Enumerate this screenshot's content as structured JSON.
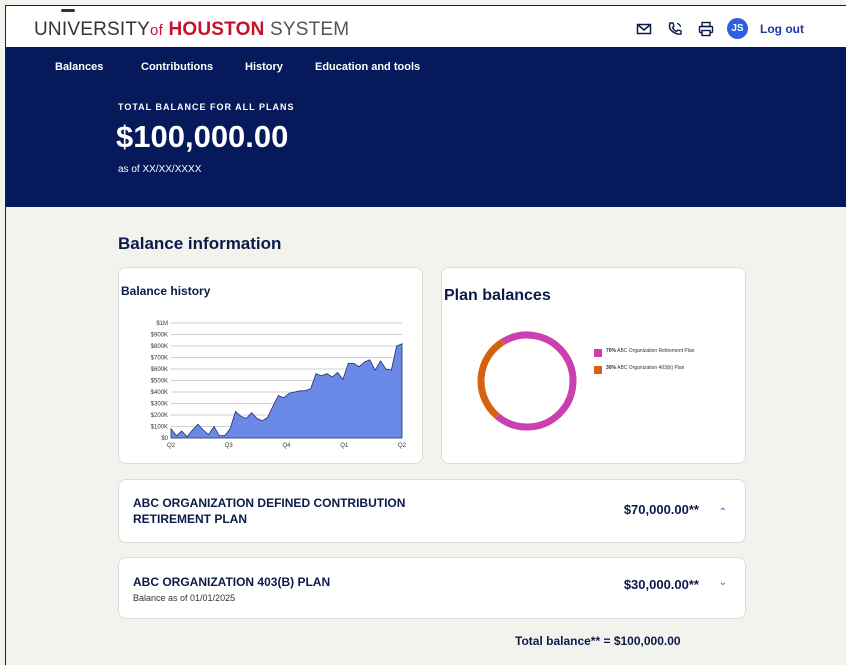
{
  "brand": {
    "university": "UNIVERSITY",
    "of": "of",
    "houston": "HOUSTON",
    "system": "SYSTEM"
  },
  "header": {
    "avatar_initials": "JS",
    "logout_label": "Log out"
  },
  "nav": {
    "items": [
      "Balances",
      "Contributions",
      "History",
      "Education and tools"
    ]
  },
  "hero": {
    "label": "TOTAL BALANCE FOR ALL PLANS",
    "amount": "$100,000.00",
    "as_of": "as of XX/XX/XXXX"
  },
  "section": {
    "title": "Balance information"
  },
  "balance_history": {
    "title": "Balance history"
  },
  "plan_balances": {
    "title": "Plan balances",
    "legend": [
      {
        "pct": "70%",
        "label": "ABC Organization Retirement Plan",
        "color": "#cc3fb0"
      },
      {
        "pct": "30%",
        "label": "ABC Organization 403(b) Plan",
        "color": "#d4620e"
      }
    ]
  },
  "plans": [
    {
      "name": "ABC ORGANIZATION DEFINED CONTRIBUTION RETIREMENT PLAN",
      "sub": "",
      "amount": "$70,000.00**",
      "chevron": "⌃"
    },
    {
      "name": "ABC ORGANIZATION 403(B) PLAN",
      "sub": "Balance as of 01/01/2025",
      "amount": "$30,000.00**",
      "chevron": "⌄"
    }
  ],
  "total": "Total balance** = $100,000.00",
  "colors": {
    "navy": "#06195a",
    "accent_blue": "#2f5ee0",
    "brand_red": "#c8102e",
    "area_fill": "#6b8ae8"
  },
  "chart_data": [
    {
      "type": "area",
      "title": "Balance history",
      "x": [
        "Q2",
        "Q3",
        "Q4",
        "Q1",
        "Q2"
      ],
      "y_ticks": [
        "$0",
        "$100K",
        "$200K",
        "$300K",
        "$400K",
        "$500K",
        "$600K",
        "$700K",
        "$800K",
        "$900K",
        "$1M"
      ],
      "ylim": [
        0,
        1000000
      ],
      "grid": true,
      "series": [
        {
          "values": [
            80000,
            20000,
            60000,
            10000,
            70000,
            120000,
            70000,
            30000,
            100000,
            20000,
            20000,
            80000,
            230000,
            190000,
            170000,
            220000,
            170000,
            150000,
            180000,
            280000,
            370000,
            350000,
            390000,
            400000,
            410000,
            410000,
            430000,
            560000,
            540000,
            560000,
            530000,
            570000,
            510000,
            650000,
            650000,
            620000,
            660000,
            680000,
            590000,
            670000,
            600000,
            590000,
            800000,
            820000
          ]
        }
      ]
    },
    {
      "type": "pie",
      "title": "Plan balances",
      "categories": [
        "ABC Organization Retirement Plan",
        "ABC Organization 403(b) Plan"
      ],
      "values": [
        70,
        30
      ],
      "legend": "right"
    }
  ]
}
